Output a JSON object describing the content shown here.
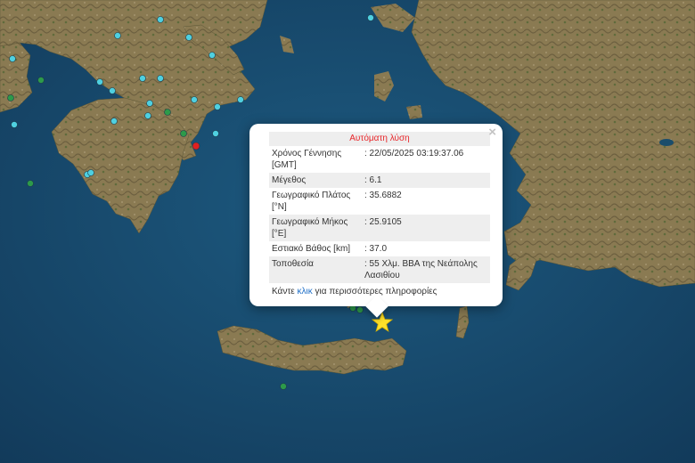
{
  "popup": {
    "title": "Αυτόματη λύση",
    "close_label": "×",
    "rows": [
      {
        "key": "Χρόνος Γέννησης [GMT]",
        "value": ": 22/05/2025 03:19:37.06"
      },
      {
        "key": "Μέγεθος",
        "value": ": 6.1"
      },
      {
        "key": "Γεωγραφικό Πλάτος [°N]",
        "value": ": 35.6882"
      },
      {
        "key": "Γεωγραφικό Μήκος [°E]",
        "value": ": 25.9105"
      },
      {
        "key": "Εστιακό Βάθος [km]",
        "value": ": 37.0"
      },
      {
        "key": "Τοποθεσία",
        "value": ": 55 Χλμ. ΒΒΑ της Νεάπολης Λασιθίου"
      }
    ],
    "footer_prefix": "Κάντε",
    "footer_link": "κλικ",
    "footer_suffix": "για περισσότερες πληροφορίες"
  },
  "colors": {
    "sea": "#174a6e",
    "land": "#8a7a52",
    "land_dark": "#6f6440",
    "marker_cyan": "#4fd0e0",
    "marker_green": "#2d9a4a",
    "marker_red": "#e02020",
    "epicenter_star": "#ffe12a"
  },
  "map_markers": [
    {
      "name": "event-marker",
      "color": "cyan"
    },
    {
      "name": "event-marker",
      "color": "green"
    },
    {
      "name": "event-marker",
      "color": "red"
    }
  ]
}
